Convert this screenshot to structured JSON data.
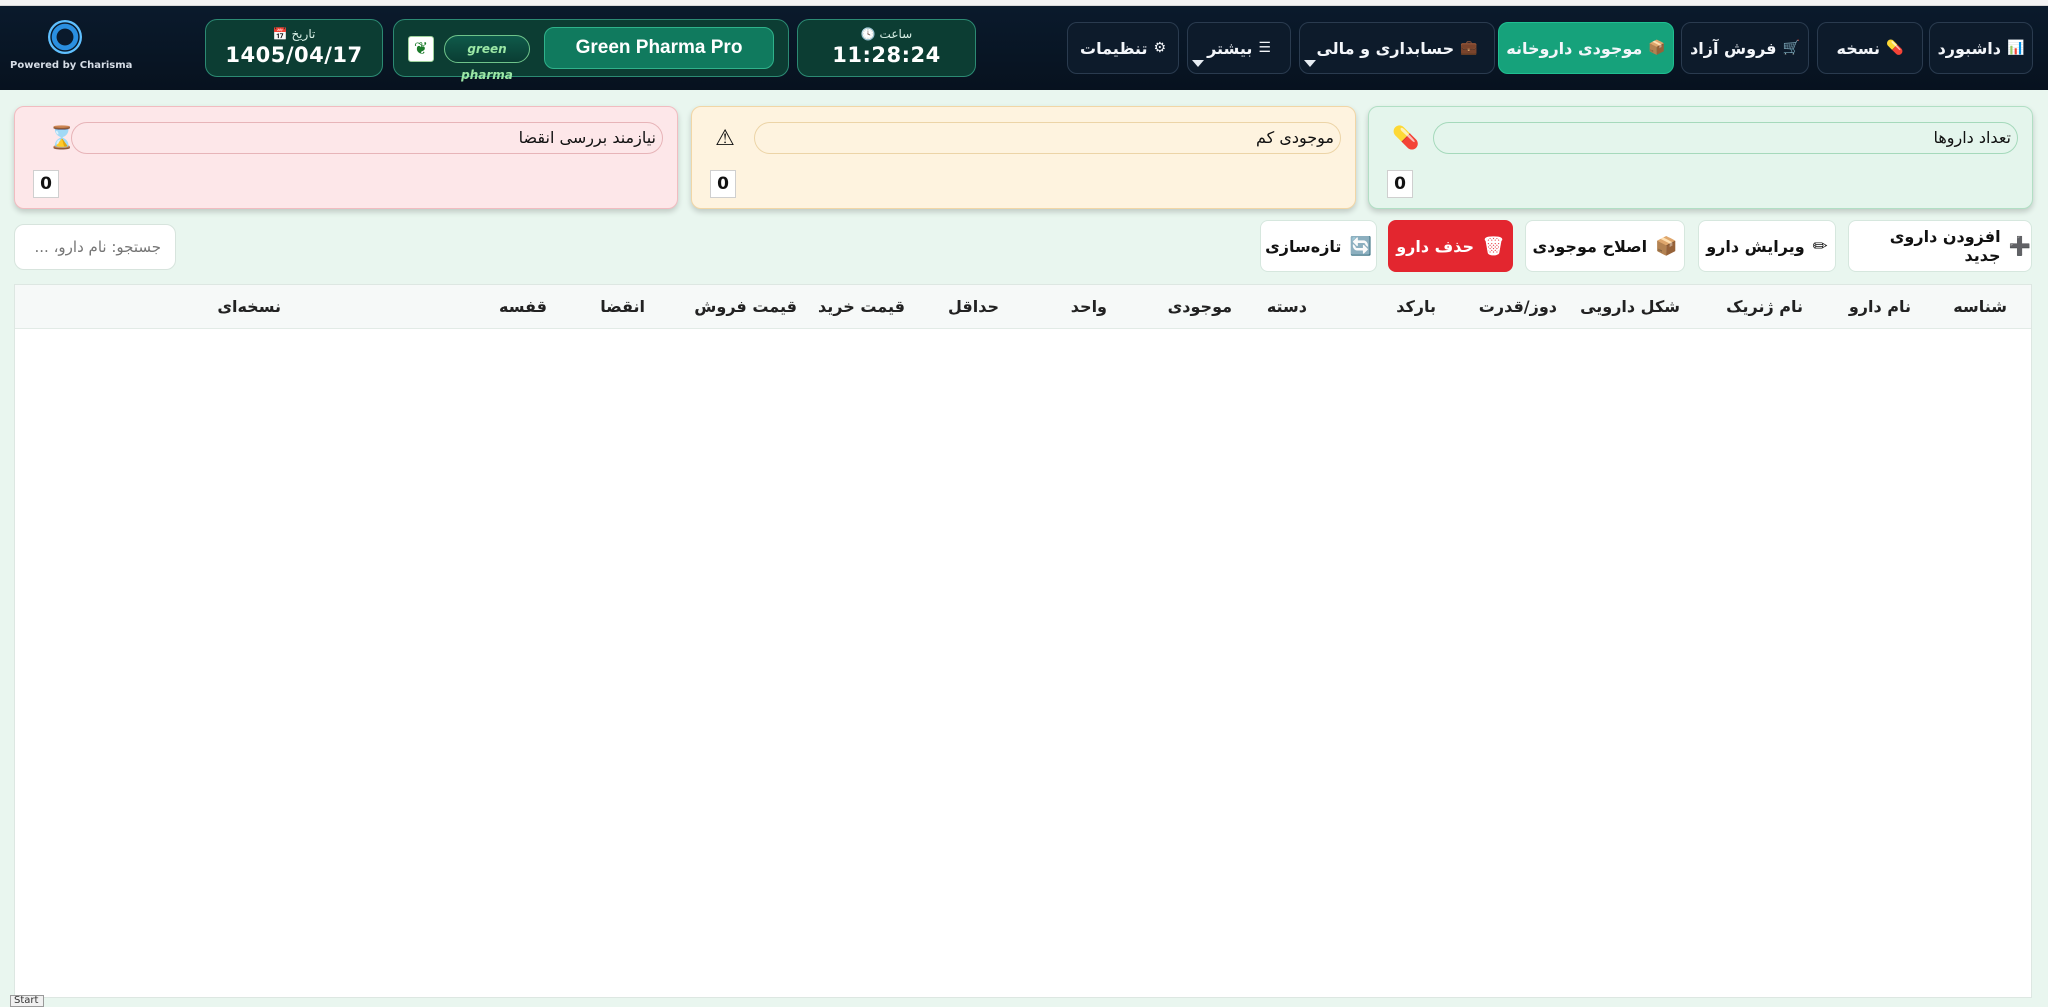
{
  "brand": {
    "powered_by": "Powered by Charisma"
  },
  "date": {
    "label": "📅 تاریخ",
    "value": "1405/04/17"
  },
  "app": {
    "logo_text": "green pharma",
    "name": "Green Pharma Pro"
  },
  "time": {
    "label": "🕓 ساعت",
    "value": "11:28:24"
  },
  "nav": [
    {
      "icon": "⚙",
      "label": "تنظیمات"
    },
    {
      "icon": "☰",
      "label": "بیشتر"
    },
    {
      "icon": "💼",
      "label": "حسابداری و مالی"
    },
    {
      "icon": "📦",
      "label": "موجودی داروخانه"
    },
    {
      "icon": "🛒",
      "label": "فروش آزاد"
    },
    {
      "icon": "💊",
      "label": "نسخه"
    },
    {
      "icon": "📊",
      "label": "داشبورد"
    }
  ],
  "stats": {
    "expiry": {
      "label": "نیازمند بررسی انقضا",
      "count": "0",
      "icon": "⌛"
    },
    "low": {
      "label": "موجودی کم",
      "count": "0",
      "icon": "⚠"
    },
    "total": {
      "label": "تعداد داروها",
      "count": "0",
      "icon": "💊"
    }
  },
  "toolbar": {
    "add": {
      "icon": "➕",
      "label": "افزودن داروی جدید"
    },
    "edit": {
      "icon": "✏",
      "label": "ویرایش دارو"
    },
    "adjust": {
      "icon": "📦",
      "label": "اصلاح موجودی"
    },
    "delete": {
      "icon": "🗑",
      "label": "حذف دارو"
    },
    "refresh": {
      "icon": "🔄",
      "label": "تازه‌سازی"
    }
  },
  "search": {
    "placeholder": "جستجو: نام دارو، ..."
  },
  "table": {
    "columns": [
      "شناسه",
      "نام دارو",
      "نام ژنریک",
      "شکل دارویی",
      "دوز/قدرت",
      "بارکد",
      "دسته",
      "موجودی",
      "واحد",
      "حداقل",
      "قیمت خرید",
      "قیمت فروش",
      "انقضا",
      "قفسه",
      "نسخه‌ای"
    ],
    "rows": []
  },
  "taskbar": {
    "start": "Start"
  }
}
